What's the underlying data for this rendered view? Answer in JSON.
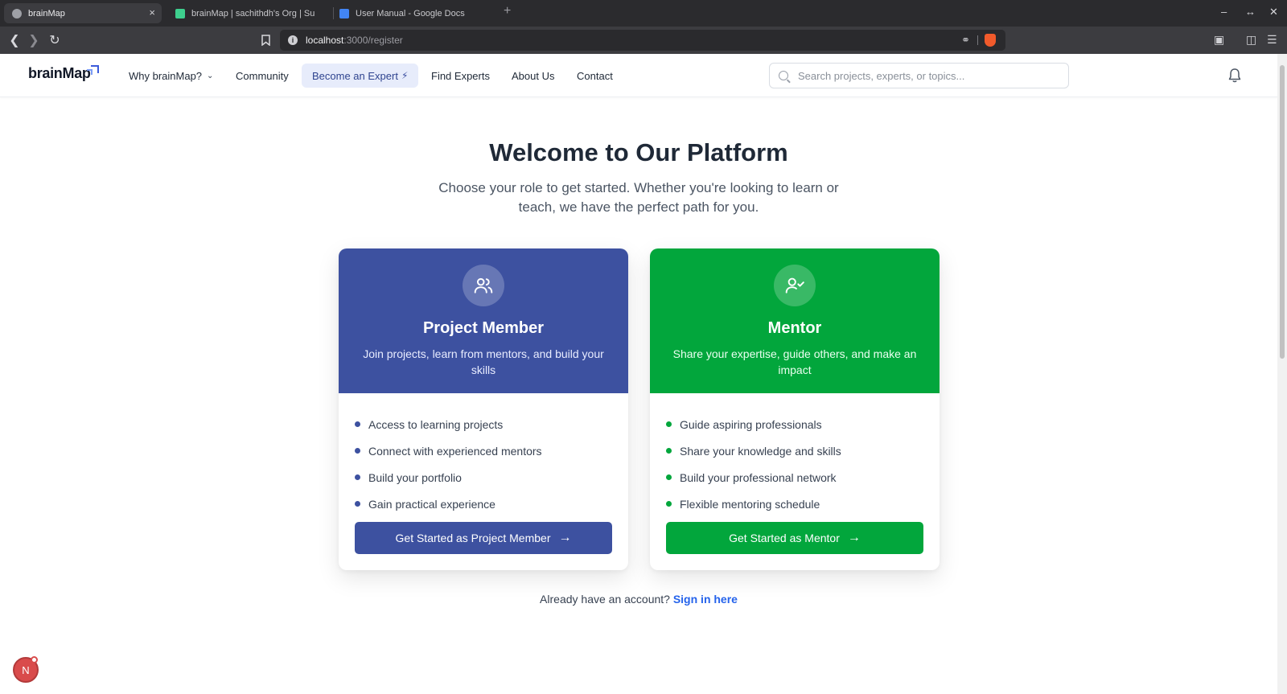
{
  "browser": {
    "tabs": [
      {
        "title": "brainMap",
        "active": true
      },
      {
        "title": "brainMap | sachithdh's Org | Su",
        "active": false
      },
      {
        "title": "User Manual - Google Docs",
        "active": false
      }
    ],
    "new_tab_symbol": "+",
    "close_symbol": "×",
    "url_host": "localhost",
    "url_path": ":3000/register"
  },
  "navbar": {
    "logo": "brainMap",
    "links": {
      "why": "Why brainMap?",
      "community": "Community",
      "become_expert": "Become an Expert",
      "find_experts": "Find Experts",
      "about": "About Us",
      "contact": "Contact"
    },
    "search_placeholder": "Search projects, experts, or topics..."
  },
  "main": {
    "title": "Welcome to Our Platform",
    "subtitle": "Choose your role to get started. Whether you're looking to learn or teach, we have the perfect path for you.",
    "cards": [
      {
        "title": "Project Member",
        "description": "Join projects, learn from mentors, and build your skills",
        "features": [
          "Access to learning projects",
          "Connect with experienced mentors",
          "Build your portfolio",
          "Gain practical experience"
        ],
        "cta": "Get Started as Project Member",
        "color": "#3d51a0",
        "icon": "users-icon"
      },
      {
        "title": "Mentor",
        "description": "Share your expertise, guide others, and make an impact",
        "features": [
          "Guide aspiring professionals",
          "Share your knowledge and skills",
          "Build your professional network",
          "Flexible mentoring schedule"
        ],
        "cta": "Get Started as Mentor",
        "color": "#02a63c",
        "icon": "user-check-icon"
      }
    ],
    "signin_prompt": "Already have an account?",
    "signin_link": "Sign in here"
  },
  "dev_badge": "N"
}
